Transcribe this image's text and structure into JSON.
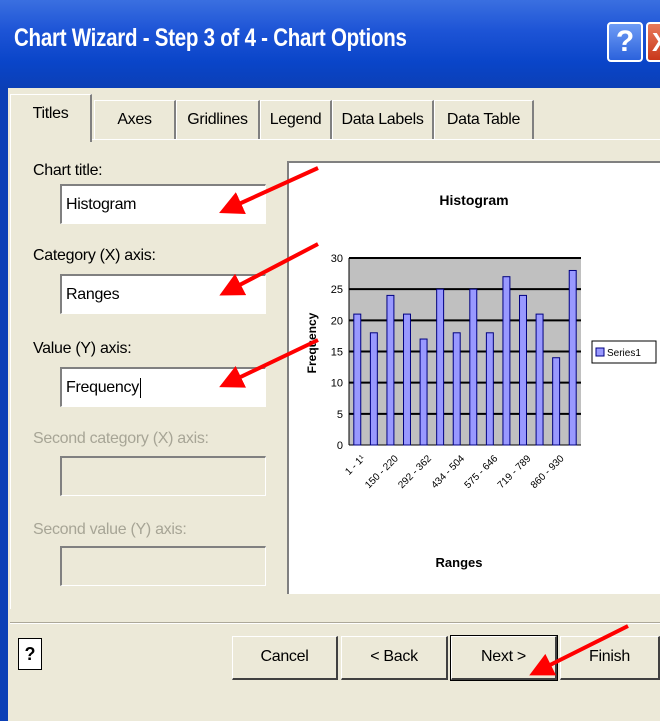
{
  "window": {
    "title": "Chart Wizard - Step 3 of 4 - Chart Options",
    "help_label": "?",
    "close_label": "X"
  },
  "tabs": [
    {
      "label": "Titles",
      "active": true
    },
    {
      "label": "Axes"
    },
    {
      "label": "Gridlines"
    },
    {
      "label": "Legend"
    },
    {
      "label": "Data Labels"
    },
    {
      "label": "Data Table"
    }
  ],
  "form": {
    "chart_title_label": "Chart title:",
    "chart_title_value": "Histogram",
    "category_x_label": "Category (X) axis:",
    "category_x_value": "Ranges",
    "value_y_label": "Value (Y) axis:",
    "value_y_value": "Frequency",
    "second_category_label": "Second category (X) axis:",
    "second_category_value": "",
    "second_value_label": "Second value (Y) axis:",
    "second_value_value": ""
  },
  "buttons": {
    "help_label": "?",
    "cancel": "Cancel",
    "back": "< Back",
    "next": "Next >",
    "finish": "Finish"
  },
  "chart_data": {
    "type": "bar",
    "title": "Histogram",
    "xlabel": "Ranges",
    "ylabel": "Frequency",
    "ylim": [
      0,
      30
    ],
    "yticks": [
      0,
      5,
      10,
      15,
      20,
      25,
      30
    ],
    "tick_labels": [
      "1 - 1¹",
      "150 - 220",
      "292 - 362",
      "434 - 504",
      "575 - 646",
      "719 - 789",
      "860 - 930"
    ],
    "series": [
      {
        "name": "Series1",
        "values": [
          21,
          18,
          24,
          21,
          17,
          25,
          18,
          25,
          18,
          27,
          24,
          21,
          14,
          28
        ]
      }
    ],
    "legend": "right",
    "grid": true,
    "colors": {
      "bar": "#9999ff",
      "plot_area": "#c0c0c0"
    }
  },
  "colors": {
    "titlebar": "#0a45c9",
    "dialog": "#ece9d8",
    "annotation_arrow": "#ff0000"
  }
}
